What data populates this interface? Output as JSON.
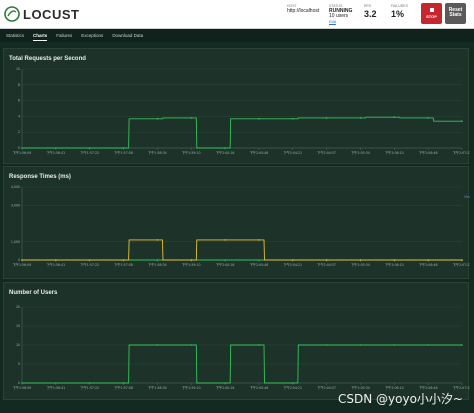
{
  "app": {
    "brand": "LOCUST"
  },
  "header": {
    "host": {
      "label": "HOST",
      "value": "http://localhost"
    },
    "status": {
      "label": "STATUS",
      "value": "RUNNING",
      "users": "10 users",
      "edit": "Edit"
    },
    "rps": {
      "label": "RPS",
      "value": "3.2"
    },
    "failures": {
      "label": "FAILURES",
      "value": "1%"
    },
    "stop_label": "STOP",
    "reset_label": "Reset Stats"
  },
  "tabs": [
    "Statistics",
    "Charts",
    "Failures",
    "Exceptions",
    "Download Data"
  ],
  "active_tab": "Charts",
  "colors": {
    "rps_line": "#35c35b",
    "median_line": "#35c35b",
    "p95_line": "#e2c23a",
    "users_line": "#35c35b",
    "stop_button": "#c6262e"
  },
  "watermark": "CSDN @yoyo小小汐~",
  "chart_data": [
    {
      "type": "line",
      "title": "Total Requests per Second",
      "ylim": [
        0,
        10
      ],
      "yticks": [
        "0",
        "2",
        "4",
        "6",
        "8",
        "10"
      ],
      "xticks": [
        "下午1:56:09",
        "下午1:56:41",
        "下午1:57:22",
        "下午1:57:58",
        "下午1:58:34",
        "下午1:59:10",
        "下午2:00:16",
        "下午2:00:46",
        "下午2:04:21",
        "下午2:04:57",
        "下午2:05:34",
        "下午2:06:10",
        "下午2:06:46",
        "下午2:07:23"
      ],
      "series": [
        {
          "name": "RPS",
          "x": [
            0,
            1,
            2,
            3,
            4,
            5,
            6,
            7,
            8,
            9,
            10,
            11,
            12,
            13
          ],
          "values": [
            0,
            0,
            0,
            0,
            3.7,
            3.8,
            0,
            3.7,
            3.7,
            3.8,
            3.8,
            3.9,
            3.8,
            3.4
          ]
        }
      ]
    },
    {
      "type": "line",
      "title": "Response Times (ms)",
      "ylim": [
        0,
        4000
      ],
      "yticks": [
        "0",
        "1,000",
        "3,000",
        "4,000"
      ],
      "xticks": [
        "下午1:56:09",
        "下午1:56:41",
        "下午1:57:22",
        "下午1:57:58",
        "下午1:58:34",
        "下午1:59:10",
        "下午2:00:16",
        "下午2:00:46",
        "下午2:04:21",
        "下午2:04:57",
        "下午2:05:34",
        "下午2:06:10",
        "下午2:06:46",
        "下午2:07:23"
      ],
      "legend_text": "Med",
      "series": [
        {
          "name": "Median",
          "x": [
            0,
            1,
            2,
            3,
            4,
            5,
            6,
            7,
            8,
            9,
            10,
            11,
            12,
            13
          ],
          "values": [
            0,
            0,
            0,
            0,
            0,
            0,
            0,
            0,
            0,
            0,
            0,
            0,
            0,
            0
          ]
        },
        {
          "name": "95%",
          "x": [
            0,
            1,
            2,
            3,
            4,
            5,
            6,
            7,
            8,
            9,
            10,
            11,
            12,
            13
          ],
          "values": [
            0,
            0,
            0,
            0,
            1100,
            0,
            1100,
            1100,
            0,
            0,
            0,
            0,
            0,
            0
          ]
        }
      ]
    },
    {
      "type": "line",
      "title": "Number of Users",
      "ylim": [
        0,
        20
      ],
      "yticks": [
        "0",
        "5",
        "10",
        "15",
        "20"
      ],
      "xticks": [
        "下午1:56:09",
        "下午1:56:41",
        "下午1:57:22",
        "下午1:57:58",
        "下午1:58:34",
        "下午1:59:10",
        "下午2:00:16",
        "下午2:00:46",
        "下午2:04:21",
        "下午2:04:57",
        "下午2:05:34",
        "下午2:06:10",
        "下午2:06:46",
        "下午2:07:23"
      ],
      "series": [
        {
          "name": "Users",
          "x": [
            0,
            1,
            2,
            3,
            4,
            5,
            6,
            7,
            8,
            9,
            10,
            11,
            12,
            13
          ],
          "values": [
            0,
            0,
            0,
            0,
            10,
            10,
            0,
            10,
            0,
            10,
            10,
            10,
            10,
            10
          ]
        }
      ]
    }
  ]
}
